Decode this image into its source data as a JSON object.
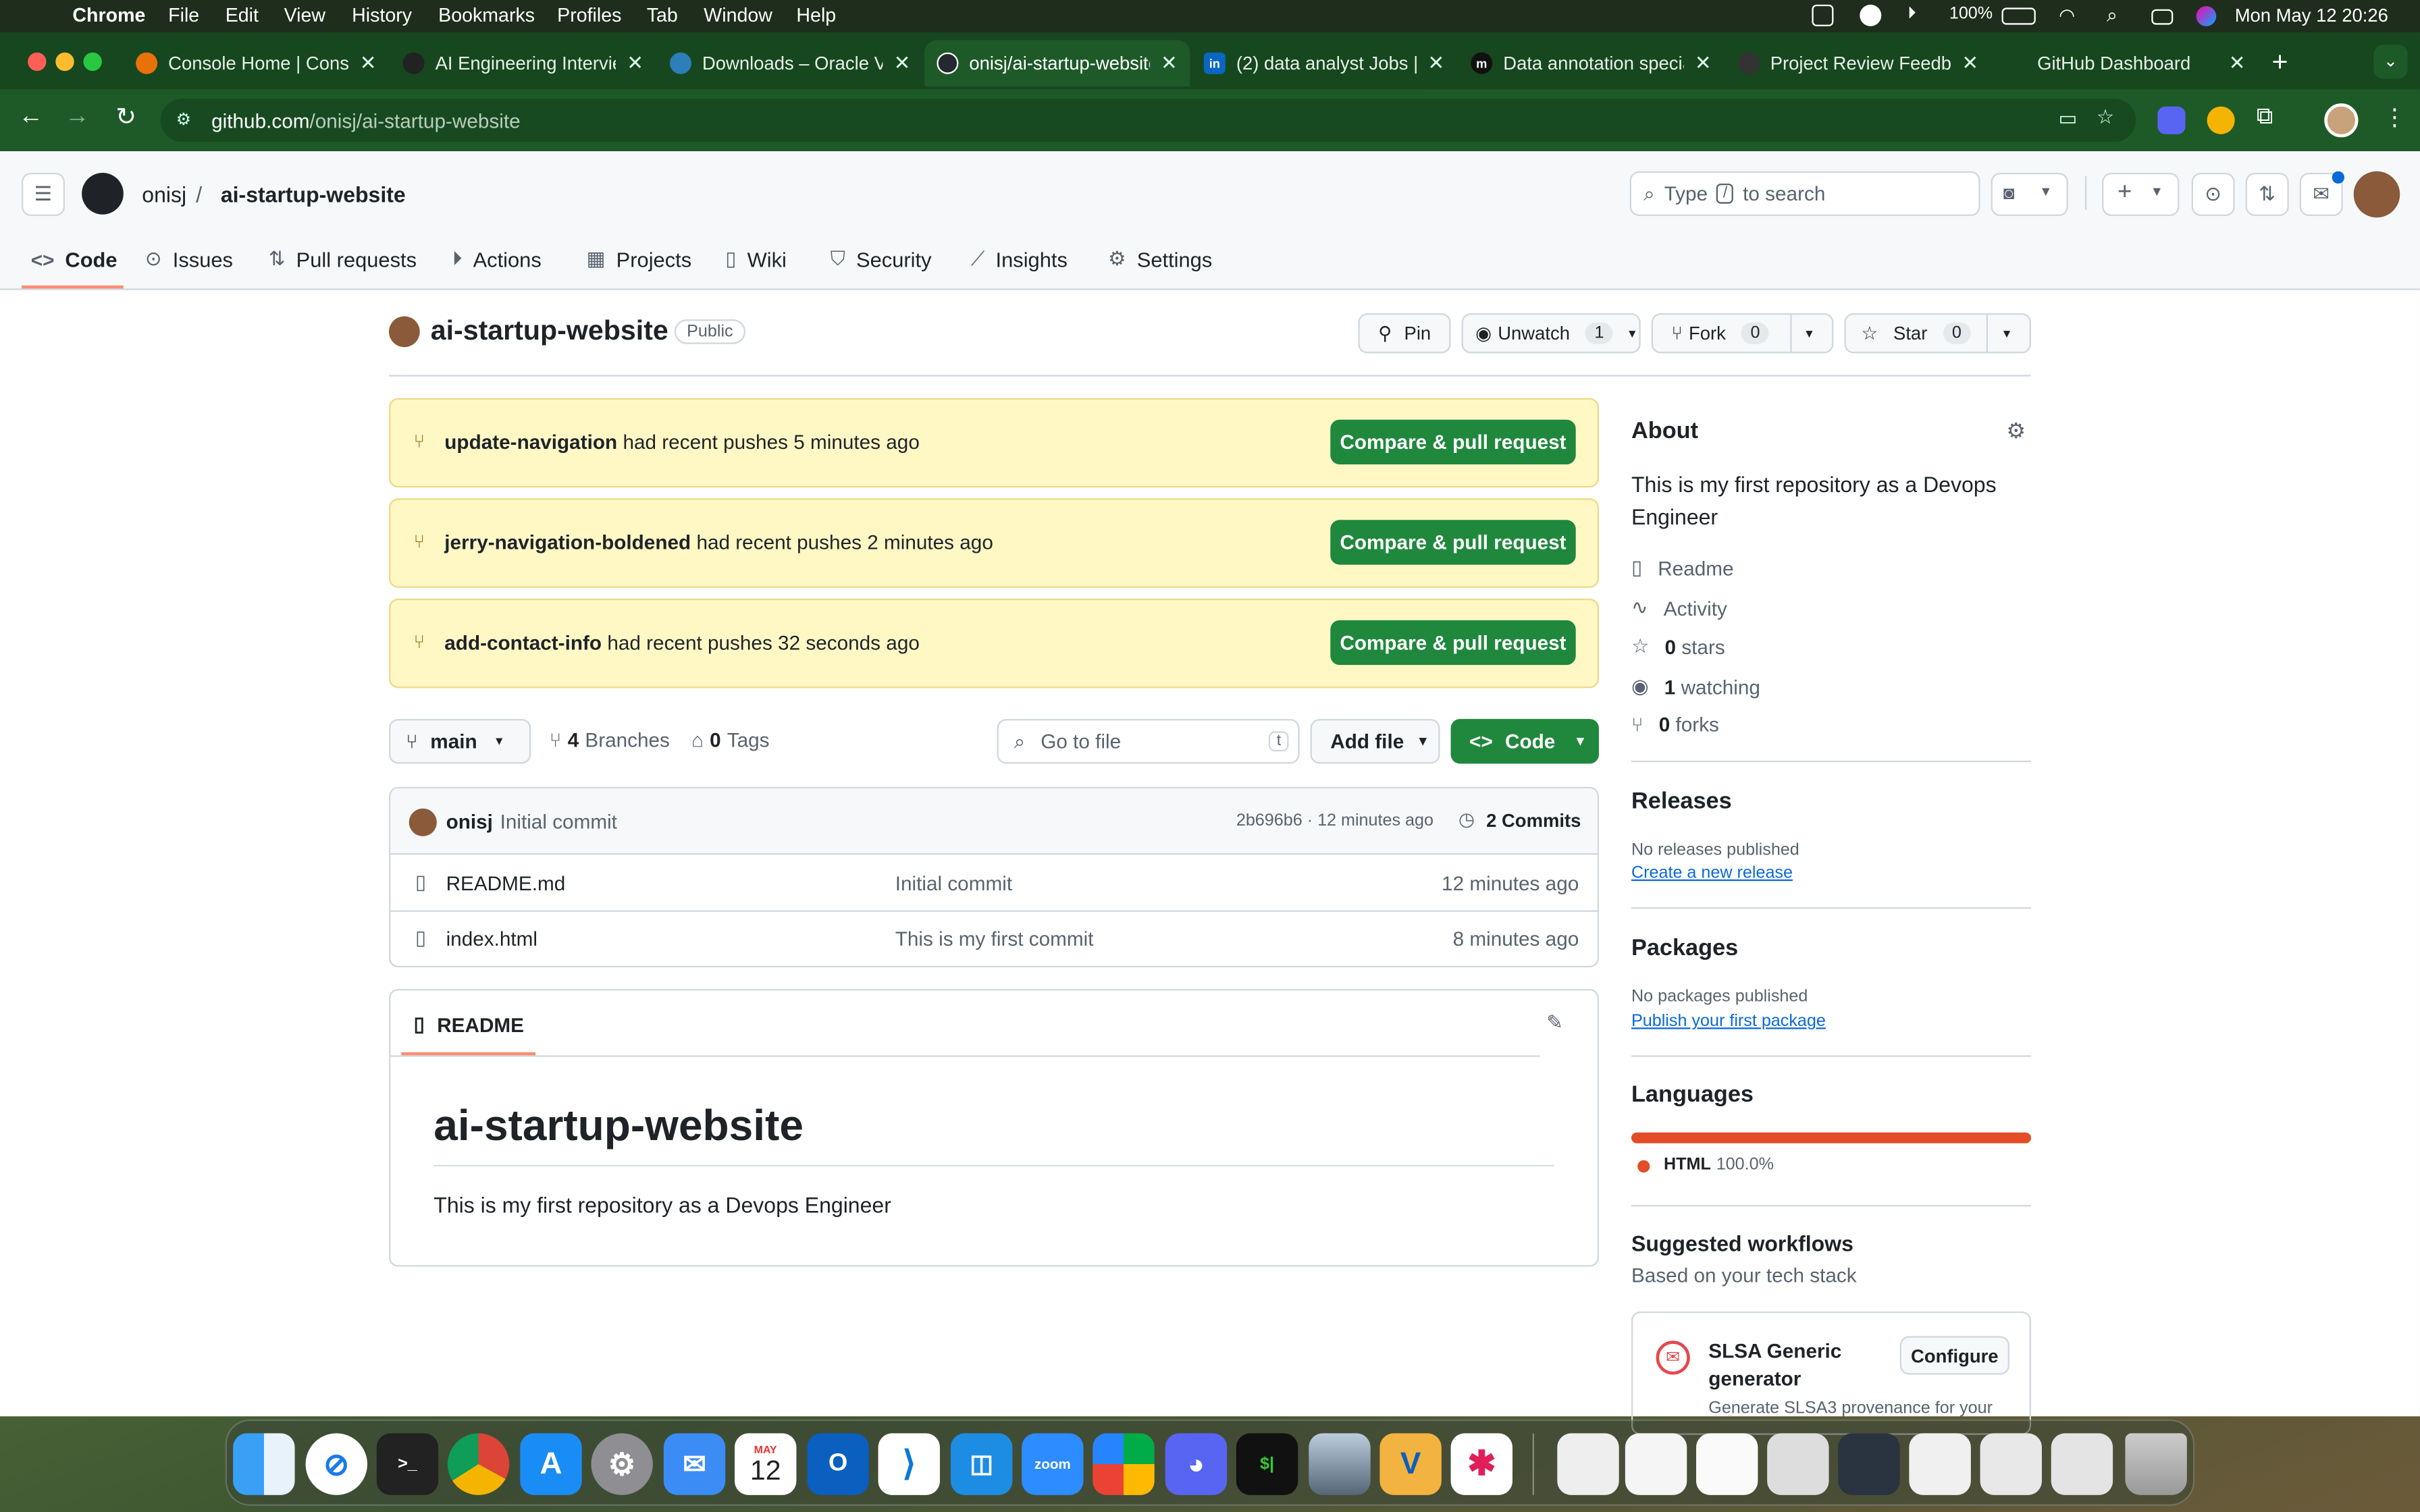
{
  "menubar": {
    "app": "Chrome",
    "items": [
      "File",
      "Edit",
      "View",
      "History",
      "Bookmarks",
      "Profiles",
      "Tab",
      "Window",
      "Help"
    ],
    "battery": "100%",
    "datetime": "Mon May 12  20:26"
  },
  "tabs": [
    {
      "title": "Console Home | Console",
      "color": "#e8710a"
    },
    {
      "title": "AI Engineering Interview",
      "color": "#222"
    },
    {
      "title": "Downloads – Oracle VM",
      "color": "#2c7fb8"
    },
    {
      "title": "onisj/ai-startup-website",
      "color": "#24292f"
    },
    {
      "title": "(2) data analyst Jobs |",
      "color": "#0a66c2"
    },
    {
      "title": "Data annotation specialist",
      "color": "#111"
    },
    {
      "title": "Project Review Feedback",
      "color": "#333"
    },
    {
      "title": "GitHub Dashboard",
      "color": "#16471f"
    }
  ],
  "url": {
    "host": "github.com",
    "path": "/onisj/ai-startup-website"
  },
  "header": {
    "owner": "onisj",
    "repo": "ai-startup-website",
    "search_placeholder_a": "Type",
    "search_key": "/",
    "search_placeholder_b": "to search"
  },
  "nav": [
    "Code",
    "Issues",
    "Pull requests",
    "Actions",
    "Projects",
    "Wiki",
    "Security",
    "Insights",
    "Settings"
  ],
  "repo": {
    "name": "ai-startup-website",
    "visibility": "Public",
    "pin": "Pin",
    "unwatch": "Unwatch",
    "watch_count": "1",
    "fork": "Fork",
    "fork_count": "0",
    "star": "Star",
    "star_count": "0"
  },
  "banners": [
    {
      "branch": "update-navigation",
      "text": "had recent pushes 5 minutes ago",
      "button": "Compare & pull request"
    },
    {
      "branch": "jerry-navigation-boldened",
      "text": "had recent pushes 2 minutes ago",
      "button": "Compare & pull request"
    },
    {
      "branch": "add-contact-info",
      "text": "had recent pushes 32 seconds ago",
      "button": "Compare & pull request"
    }
  ],
  "branchbar": {
    "branch": "main",
    "branches_count": "4",
    "branches_label": "Branches",
    "tags_count": "0",
    "tags_label": "Tags",
    "goto_placeholder": "Go to file",
    "goto_key": "t",
    "add_file": "Add file",
    "code": "Code"
  },
  "commit": {
    "author": "onisj",
    "message": "Initial commit",
    "hash": "2b696b6 · 12 minutes ago",
    "commits": "2 Commits"
  },
  "files": [
    {
      "name": "README.md",
      "message": "Initial commit",
      "time": "12 minutes ago"
    },
    {
      "name": "index.html",
      "message": "This is my first commit",
      "time": "8 minutes ago"
    }
  ],
  "readme": {
    "tab": "README",
    "h1": "ai-startup-website",
    "body": "This is my first repository as a Devops Engineer"
  },
  "about": {
    "title": "About",
    "desc": "This is my first repository as a Devops Engineer",
    "readme": "Readme",
    "activity": "Activity",
    "stars_n": "0",
    "stars": "stars",
    "watching_n": "1",
    "watching": "watching",
    "forks_n": "0",
    "forks": "forks"
  },
  "releases": {
    "title": "Releases",
    "none": "No releases published",
    "link": "Create a new release"
  },
  "packages": {
    "title": "Packages",
    "none": "No packages published",
    "link": "Publish your first package"
  },
  "languages": {
    "title": "Languages",
    "name": "HTML",
    "pct": "100.0%",
    "color": "#e34c26"
  },
  "workflows": {
    "title": "Suggested workflows",
    "sub": "Based on your tech stack",
    "card_title": "SLSA Generic generator",
    "card_btn": "Configure",
    "card_desc": "Generate SLSA3 provenance for your"
  },
  "dock": {
    "calendar_month": "MAY",
    "calendar_day": "12",
    "zoom": "zoom"
  }
}
